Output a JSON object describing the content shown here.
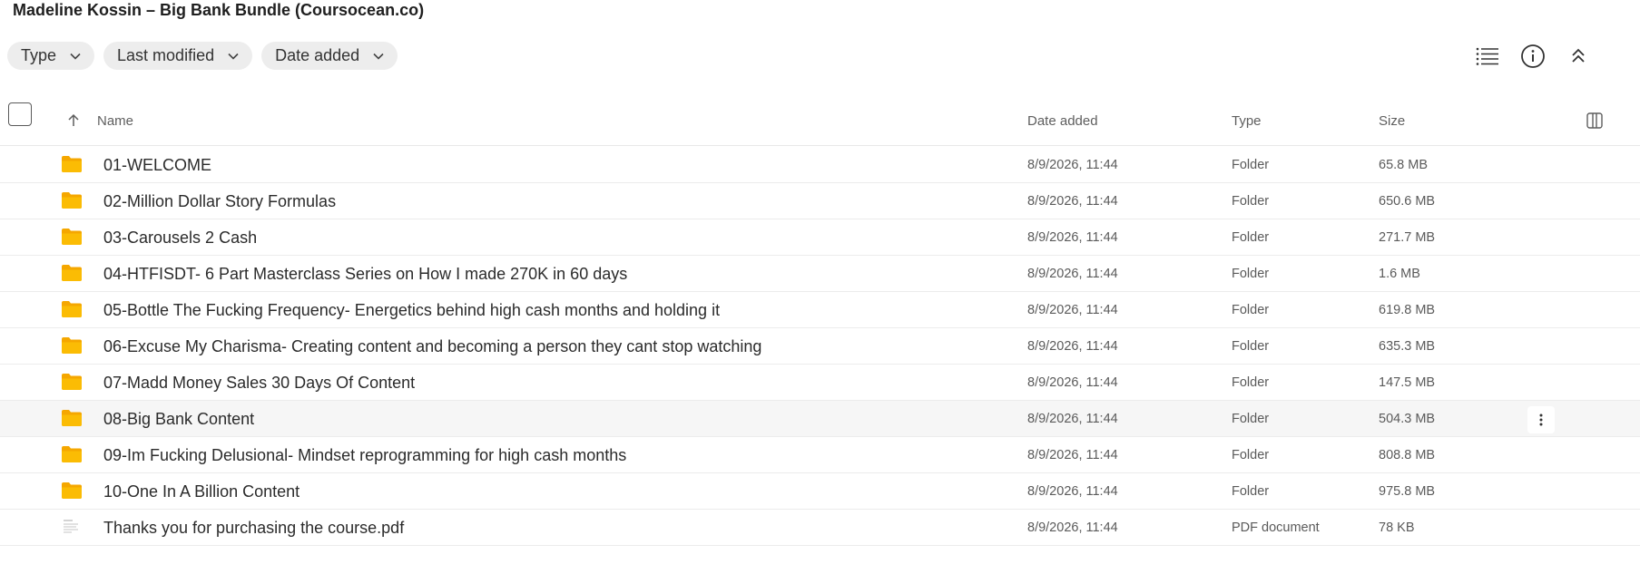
{
  "page": {
    "title": "Madeline Kossin – Big Bank Bundle (Coursocean.co)"
  },
  "filters": [
    {
      "label": "Type"
    },
    {
      "label": "Last modified"
    },
    {
      "label": "Date added"
    }
  ],
  "toolbar_icons": [
    "list-view-icon",
    "info-icon",
    "collapse-icon"
  ],
  "columns": {
    "name": "Name",
    "date_added": "Date added",
    "type": "Type",
    "size": "Size"
  },
  "sort": {
    "column": "name",
    "direction": "ascending"
  },
  "colors": {
    "folder": "#FBBC04",
    "folder_back": "#F5A700",
    "highlight_row": "#F6F6F6"
  },
  "files": [
    {
      "name": "01-WELCOME",
      "date": "8/9/2026, 11:44",
      "type": "Folder",
      "size": "65.8 MB",
      "kind": "folder"
    },
    {
      "name": "02-Million Dollar Story Formulas",
      "date": "8/9/2026, 11:44",
      "type": "Folder",
      "size": "650.6 MB",
      "kind": "folder"
    },
    {
      "name": "03-Carousels 2 Cash",
      "date": "8/9/2026, 11:44",
      "type": "Folder",
      "size": "271.7 MB",
      "kind": "folder"
    },
    {
      "name": "04-HTFISDT- 6 Part Masterclass Series on How I made 270K in 60 days",
      "date": "8/9/2026, 11:44",
      "type": "Folder",
      "size": "1.6 MB",
      "kind": "folder"
    },
    {
      "name": "05-Bottle The Fucking Frequency- Energetics behind high cash months and holding it",
      "date": "8/9/2026, 11:44",
      "type": "Folder",
      "size": "619.8 MB",
      "kind": "folder"
    },
    {
      "name": "06-Excuse My Charisma- Creating content and becoming a person they cant stop watching",
      "date": "8/9/2026, 11:44",
      "type": "Folder",
      "size": "635.3 MB",
      "kind": "folder"
    },
    {
      "name": "07-Madd Money Sales 30 Days Of Content",
      "date": "8/9/2026, 11:44",
      "type": "Folder",
      "size": "147.5 MB",
      "kind": "folder"
    },
    {
      "name": "08-Big Bank Content",
      "date": "8/9/2026, 11:44",
      "type": "Folder",
      "size": "504.3 MB",
      "kind": "folder",
      "highlighted": true
    },
    {
      "name": "09-Im Fucking Delusional- Mindset reprogramming for high cash months",
      "date": "8/9/2026, 11:44",
      "type": "Folder",
      "size": "808.8 MB",
      "kind": "folder"
    },
    {
      "name": "10-One In A Billion Content",
      "date": "8/9/2026, 11:44",
      "type": "Folder",
      "size": "975.8 MB",
      "kind": "folder"
    },
    {
      "name": "Thanks you for purchasing the course.pdf",
      "date": "8/9/2026, 11:44",
      "type": "PDF document",
      "size": "78 KB",
      "kind": "pdf"
    }
  ]
}
